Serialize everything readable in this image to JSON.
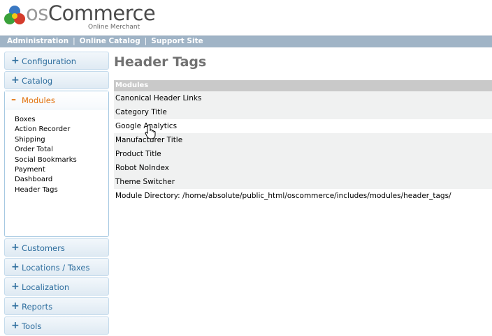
{
  "brand": {
    "name_prefix": "os",
    "name_main": "Commerce",
    "subtitle": "Online Merchant"
  },
  "topbar": {
    "links": [
      "Administration",
      "Online Catalog",
      "Support Site"
    ],
    "separator": "|"
  },
  "sidebar": {
    "sections": [
      {
        "label": "Configuration",
        "expanded": false
      },
      {
        "label": "Catalog",
        "expanded": false
      },
      {
        "label": "Modules",
        "expanded": true,
        "items": [
          "Boxes",
          "Action Recorder",
          "Shipping",
          "Order Total",
          "Social Bookmarks",
          "Payment",
          "Dashboard",
          "Header Tags"
        ]
      },
      {
        "label": "Customers",
        "expanded": false
      },
      {
        "label": "Locations / Taxes",
        "expanded": false
      },
      {
        "label": "Localization",
        "expanded": false
      },
      {
        "label": "Reports",
        "expanded": false
      },
      {
        "label": "Tools",
        "expanded": false
      }
    ],
    "plus_glyph": "+",
    "minus_glyph": "–"
  },
  "main": {
    "title": "Header Tags",
    "table_header": "Modules",
    "modules": [
      "Canonical Header Links",
      "Category Title",
      "Google Analytics",
      "Manufacturer Title",
      "Product Title",
      "Robot NoIndex",
      "Theme Switcher"
    ],
    "directory_label": "Module Directory:",
    "directory_path": "/home/absolute/public_html/oscommerce/includes/modules/header_tags/"
  },
  "colors": {
    "accent": "#2e6e9e",
    "active": "#e17009",
    "topbar": "#a0b4c6",
    "table_header": "#c9c9c9",
    "row_alt": "#f0f1f1"
  },
  "icons": {
    "logo": "oscommerce-logo-icon",
    "cursor": "hand-pointer-icon"
  }
}
